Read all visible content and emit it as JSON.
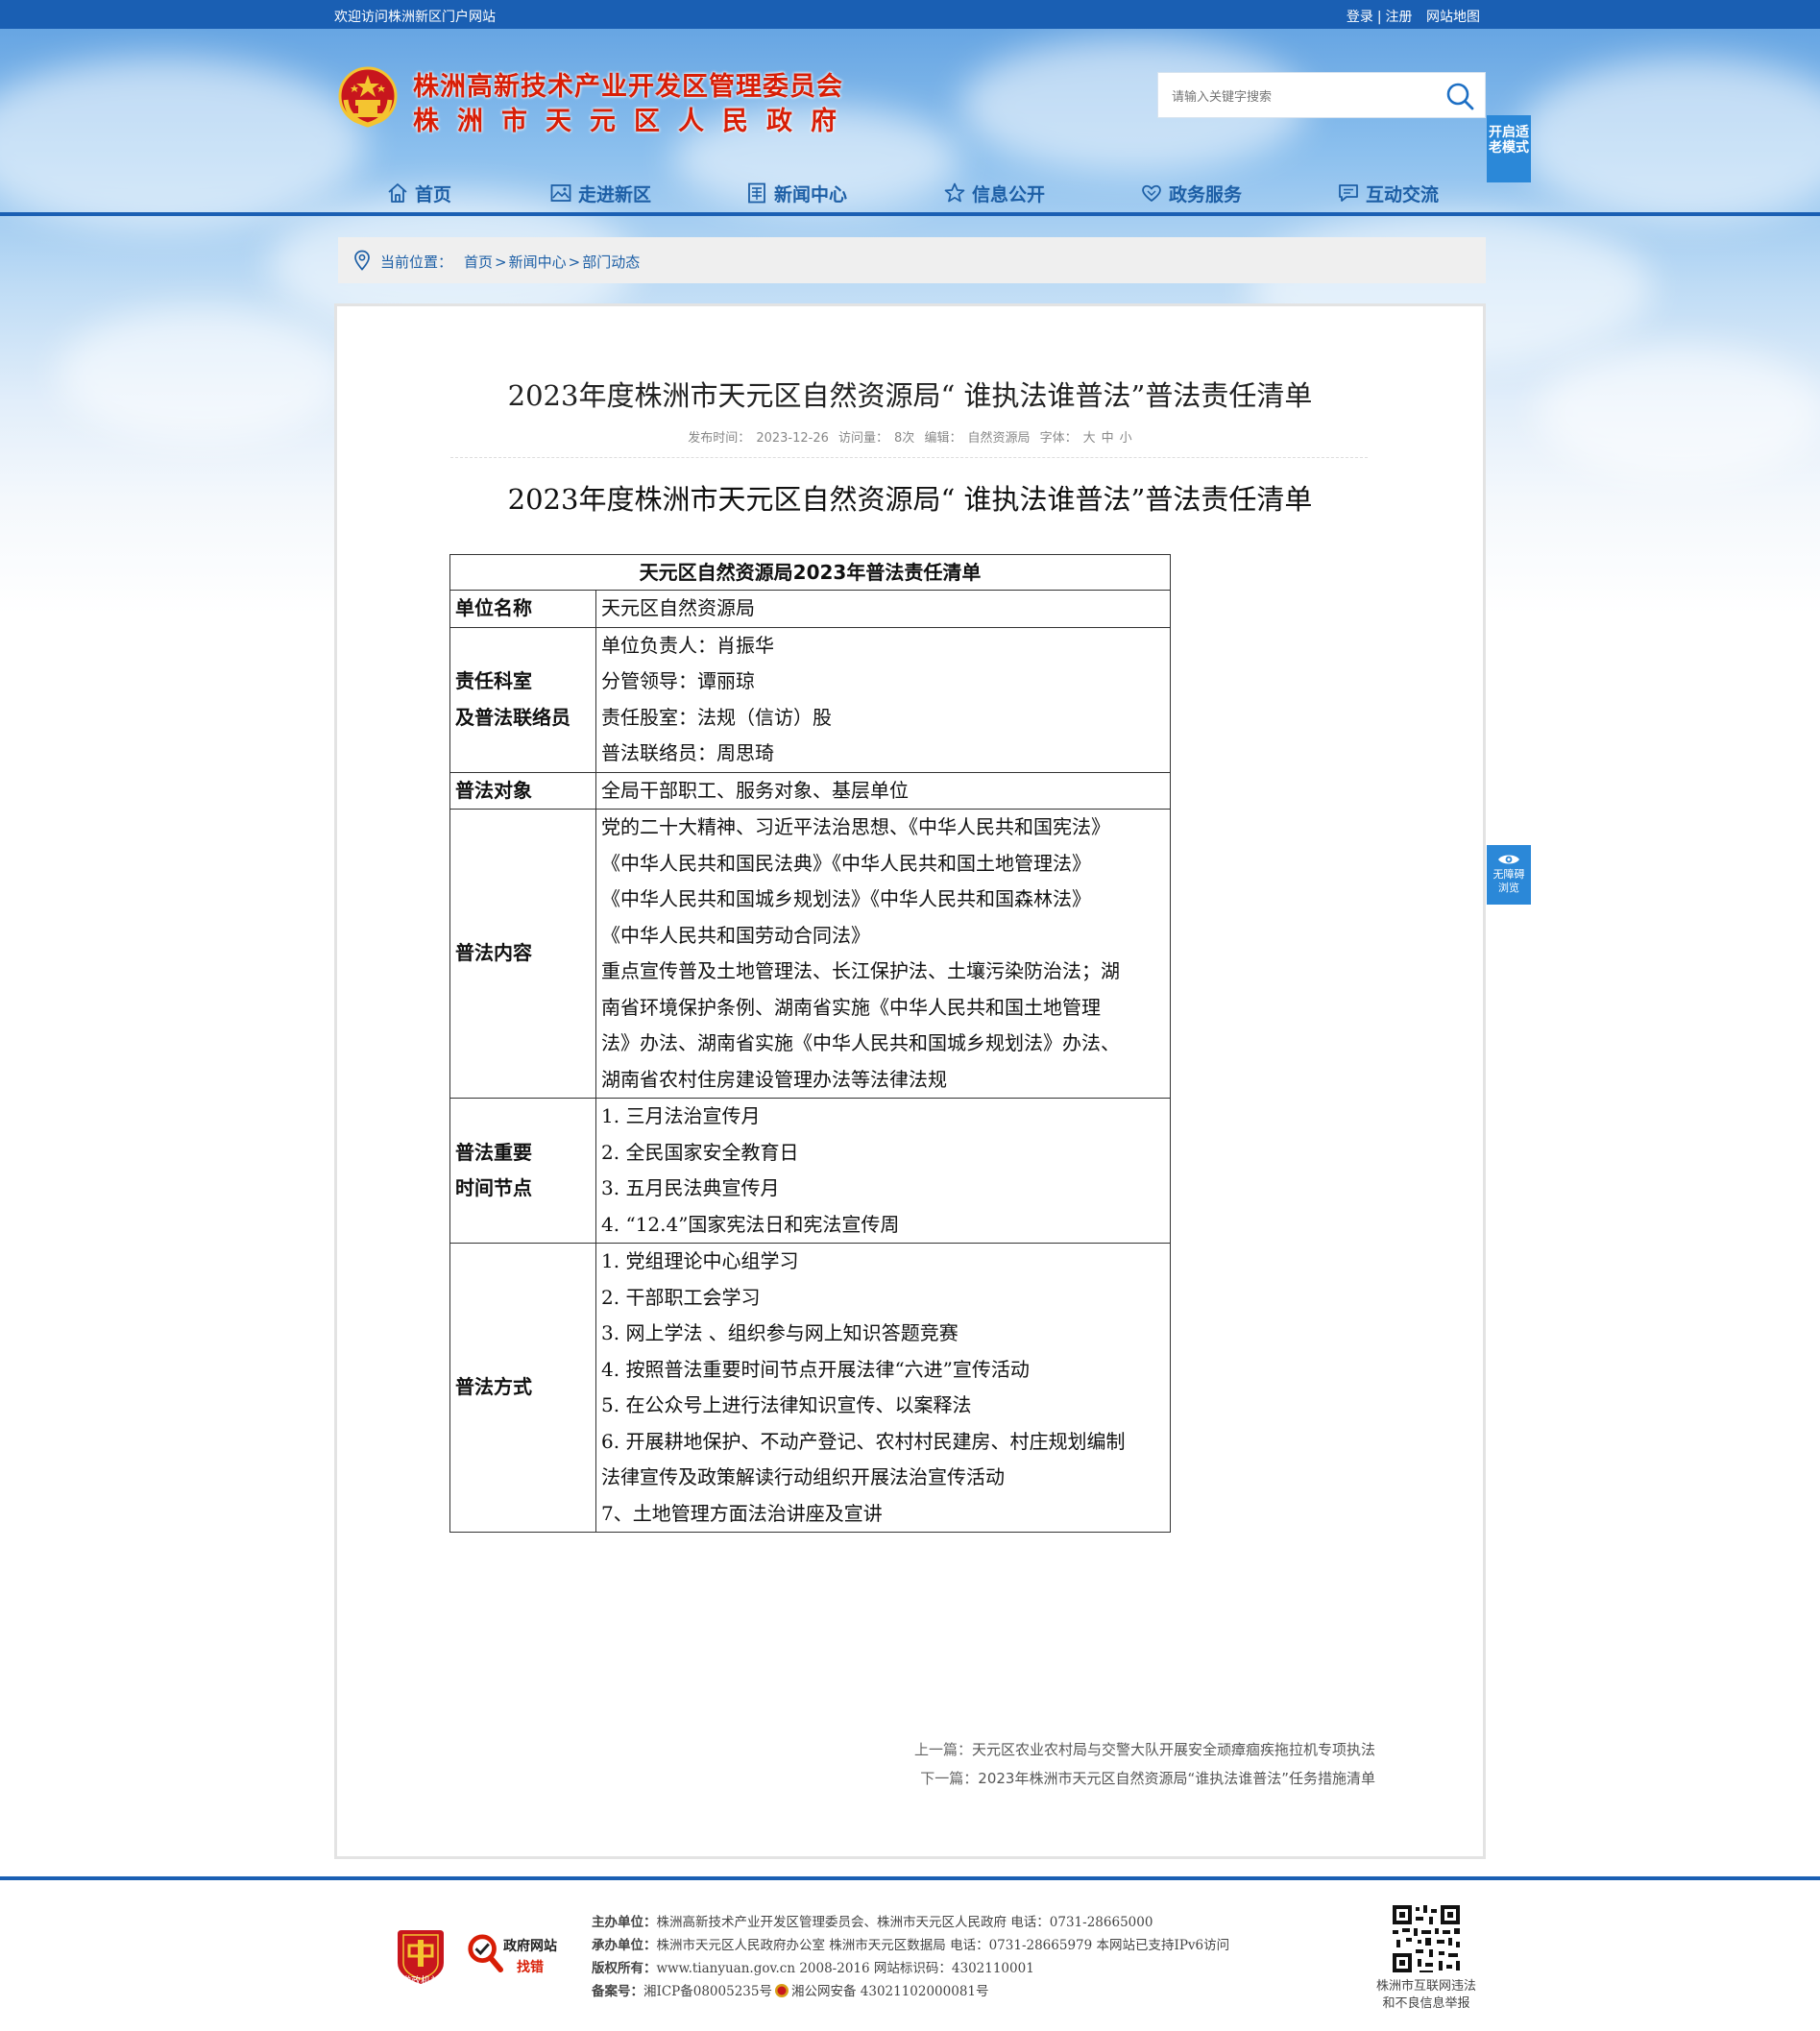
{
  "topbar": {
    "welcome": "欢迎访问株洲新区门户网站",
    "login": "登录",
    "divider": "|",
    "register": "注册",
    "sitemap": "网站地图"
  },
  "header": {
    "title_line1": "株洲高新技术产业开发区管理委员会",
    "title_line2": "株洲市天元区人民政府"
  },
  "search": {
    "placeholder": "请输入关键字搜索"
  },
  "elder_mode": {
    "label": "开启适老模式"
  },
  "nav": {
    "items": [
      {
        "label": "首页",
        "icon": "home-icon"
      },
      {
        "label": "走进新区",
        "icon": "picture-icon"
      },
      {
        "label": "新闻中心",
        "icon": "newspaper-icon"
      },
      {
        "label": "信息公开",
        "icon": "star-icon"
      },
      {
        "label": "政务服务",
        "icon": "heart-icon"
      },
      {
        "label": "互动交流",
        "icon": "chat-icon"
      }
    ]
  },
  "breadcrumb": {
    "prefix": "当前位置：",
    "home": "首页",
    "sep": ">",
    "news": "新闻中心",
    "dept": "部门动态"
  },
  "article": {
    "title": "2023年度株洲市天元区自然资源局“ 谁执法谁普法”普法责任清单",
    "meta": {
      "publish_label": "发布时间：",
      "publish_date": "2023-12-26",
      "views_label": "访问量：",
      "views": "8次",
      "editor_label": "编辑：",
      "editor": "自然资源局",
      "font_label": "字体：",
      "font_large": "大",
      "font_medium": "中",
      "font_small": "小"
    },
    "subtitle": "2023年度株洲市天元区自然资源局“ 谁执法谁普法”普法责任清单",
    "table": {
      "header": "天元区自然资源局2023年普法责任清单",
      "rows": [
        {
          "key": "单位名称",
          "lines": [
            "天元区自然资源局"
          ]
        },
        {
          "key": "责任科室及普法联络员",
          "key_lines": [
            "责任科室",
            "及普法联络员"
          ],
          "lines": [
            "单位负责人：肖振华",
            "分管领导：谭丽琼",
            "责任股室：法规（信访）股",
            "普法联络员：周思琦"
          ]
        },
        {
          "key": "普法对象",
          "lines": [
            "全局干部职工、服务对象、基层单位"
          ]
        },
        {
          "key": "普法内容",
          "lines": [
            "党的二十大精神、习近平法治思想、《中华人民共和国宪法》",
            "《中华人民共和国民法典》《中华人民共和国土地管理法》",
            "《中华人民共和国城乡规划法》《中华人民共和国森林法》",
            "《中华人民共和国劳动合同法》",
            "重点宣传普及土地管理法、长江保护法、土壤污染防治法；湖",
            "南省环境保护条例、湖南省实施《中华人民共和国土地管理",
            "法》办法、湖南省实施《中华人民共和国城乡规划法》办法、",
            "湖南省农村住房建设管理办法等法律法规"
          ]
        },
        {
          "key": "普法重要时间节点",
          "key_lines": [
            "普法重要",
            "时间节点"
          ],
          "lines": [
            "1. 三月法治宣传月",
            "2. 全民国家安全教育日",
            "3. 五月民法典宣传月",
            "4. “12.4”国家宪法日和宪法宣传周"
          ]
        },
        {
          "key": "普法方式",
          "lines": [
            "1. 党组理论中心组学习",
            "2. 干部职工会学习",
            "3. 网上学法 、组织参与网上知识答题竞赛",
            "4. 按照普法重要时间节点开展法律“六进”宣传活动",
            "5. 在公众号上进行法律知识宣传、以案释法",
            "6. 开展耕地保护、不动产登记、农村村民建房、村庄规划编制",
            "法律宣传及政策解读行动组织开展法治宣传活动",
            "7、土地管理方面法治讲座及宣讲"
          ]
        }
      ]
    },
    "prev_label": "上一篇：",
    "prev_title": "天元区农业农村局与交警大队开展安全顽瘴痼疾拖拉机专项执法",
    "next_label": "下一篇：",
    "next_title": "2023年株洲市天元区自然资源局“谁执法谁普法”任务措施清单"
  },
  "accessibility": {
    "label_line1": "无障碍",
    "label_line2": "浏览"
  },
  "footer": {
    "badge1_text": "党政机关",
    "badge2_line1": "政府网站",
    "badge2_line2": "找错",
    "host_label": "主办单位：",
    "host": "株洲高新技术产业开发区管理委员会、株洲市天元区人民政府 电话：0731-28665000",
    "organizer_label": "承办单位：",
    "organizer": "株洲市天元区人民政府办公室 株洲市天元区数据局 电话：0731-28665979 本网站已支持IPv6访问",
    "copyright_label": "版权所有：",
    "copyright": "www.tianyuan.gov.cn 2008-2016 网站标识码：4302110001",
    "icp_label": "备案号：",
    "icp": "湘ICP备08005235号",
    "police": "湘公网安备 43021102000081号",
    "qr_caption_line1": "株洲市互联网违法",
    "qr_caption_line2": "和不良信息举报"
  },
  "colors": {
    "brand_blue": "#1a5fb3",
    "accent_blue": "#2b88d8",
    "title_red": "#d81e06"
  }
}
